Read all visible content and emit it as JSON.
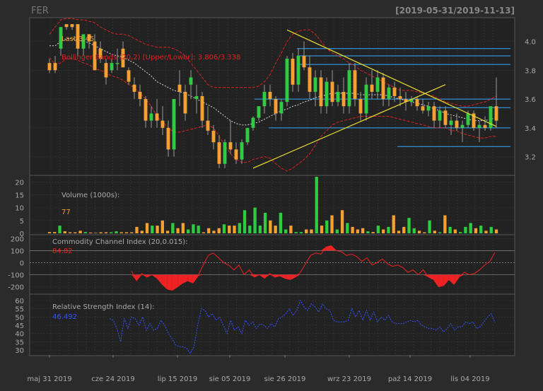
{
  "header": {
    "symbol": "FER",
    "range": "[2019-05-31/2019-11-13]"
  },
  "colors": {
    "background": "#2b2b2b",
    "panel": "#222222",
    "grid": "#444444",
    "up": "#2ecc40",
    "down": "#f5a030",
    "bollinger": "#dd2222",
    "bollinger_mid": "#dddddd",
    "trend": "#e8e030",
    "levels": "#33aaff",
    "cci": "#ee2222",
    "rsi": "#3355ff",
    "text": "#aaaaaa"
  },
  "chart_data": [
    {
      "type": "candlestick",
      "panel": "price",
      "legend": [
        {
          "text": "Last 3.45",
          "color": "#f5a030"
        },
        {
          "text": "Bollinger Bands (20,2) [Upper/Lower]: 3.806/3.338",
          "color": "#dd2222"
        }
      ],
      "y_ticks": [
        "4.0",
        "3.8",
        "3.6",
        "3.4",
        "3.2"
      ],
      "ylim": [
        3.08,
        4.16
      ],
      "x_labels": [
        "maj 31 2019",
        "cze 24 2019",
        "lip 15 2019",
        "sie 05 2019",
        "sie 26 2019",
        "wrz 23 2019",
        "paź 14 2019",
        "lis 04 2019"
      ],
      "horizontal_levels": [
        3.95,
        3.9,
        3.84,
        3.6,
        3.54,
        3.4,
        3.27
      ],
      "ohlc": [
        [
          3.85,
          3.88,
          3.78,
          3.8
        ],
        [
          3.85,
          3.9,
          3.78,
          3.8
        ],
        [
          3.95,
          4.1,
          3.9,
          4.1
        ],
        [
          4.12,
          4.12,
          4.08,
          4.1
        ],
        [
          4.12,
          4.12,
          4.08,
          4.1
        ],
        [
          4.12,
          4.12,
          3.9,
          3.95
        ],
        [
          3.95,
          4.05,
          3.9,
          4.05
        ],
        [
          4.05,
          4.05,
          3.95,
          4.0
        ],
        [
          4.0,
          4.05,
          3.8,
          3.8
        ],
        [
          3.95,
          4.0,
          3.85,
          3.88
        ],
        [
          3.85,
          3.88,
          3.7,
          3.75
        ],
        [
          3.8,
          3.88,
          3.78,
          3.85
        ],
        [
          3.85,
          3.95,
          3.8,
          3.85
        ],
        [
          3.95,
          4.0,
          3.82,
          3.82
        ],
        [
          3.8,
          3.82,
          3.7,
          3.72
        ],
        [
          3.7,
          3.75,
          3.6,
          3.65
        ],
        [
          3.65,
          3.7,
          3.55,
          3.6
        ],
        [
          3.6,
          3.62,
          3.4,
          3.45
        ],
        [
          3.45,
          3.55,
          3.4,
          3.5
        ],
        [
          3.5,
          3.6,
          3.4,
          3.45
        ],
        [
          3.45,
          3.55,
          3.35,
          3.4
        ],
        [
          3.4,
          3.45,
          3.2,
          3.25
        ],
        [
          3.25,
          3.6,
          3.2,
          3.6
        ],
        [
          3.7,
          3.8,
          3.55,
          3.65
        ],
        [
          3.65,
          3.7,
          3.45,
          3.5
        ],
        [
          3.7,
          3.8,
          3.6,
          3.75
        ],
        [
          3.6,
          3.7,
          3.5,
          3.62
        ],
        [
          3.62,
          3.65,
          3.4,
          3.45
        ],
        [
          3.45,
          3.55,
          3.35,
          3.38
        ],
        [
          3.38,
          3.42,
          3.25,
          3.3
        ],
        [
          3.3,
          3.35,
          3.12,
          3.15
        ],
        [
          3.15,
          3.32,
          3.12,
          3.3
        ],
        [
          3.3,
          3.45,
          3.22,
          3.25
        ],
        [
          3.25,
          3.3,
          3.15,
          3.18
        ],
        [
          3.18,
          3.32,
          3.15,
          3.3
        ],
        [
          3.3,
          3.4,
          3.28,
          3.4
        ],
        [
          3.4,
          3.48,
          3.38,
          3.47
        ],
        [
          3.47,
          3.55,
          3.45,
          3.55
        ],
        [
          3.55,
          3.7,
          3.5,
          3.65
        ],
        [
          3.65,
          3.7,
          3.55,
          3.6
        ],
        [
          3.6,
          3.62,
          3.45,
          3.5
        ],
        [
          3.5,
          3.6,
          3.45,
          3.58
        ],
        [
          3.58,
          3.9,
          3.55,
          3.88
        ],
        [
          3.88,
          3.92,
          3.65,
          3.7
        ],
        [
          3.7,
          3.95,
          3.65,
          3.9
        ],
        [
          3.9,
          4.0,
          3.8,
          3.82
        ],
        [
          3.82,
          3.9,
          3.6,
          3.65
        ],
        [
          3.65,
          3.8,
          3.55,
          3.75
        ],
        [
          3.75,
          3.8,
          3.5,
          3.55
        ],
        [
          3.55,
          3.75,
          3.5,
          3.72
        ],
        [
          3.72,
          3.8,
          3.55,
          3.58
        ],
        [
          3.58,
          3.7,
          3.55,
          3.65
        ],
        [
          3.65,
          3.75,
          3.5,
          3.55
        ],
        [
          3.55,
          3.85,
          3.5,
          3.8
        ],
        [
          3.8,
          3.85,
          3.55,
          3.6
        ],
        [
          3.6,
          3.65,
          3.45,
          3.5
        ],
        [
          3.5,
          3.75,
          3.45,
          3.7
        ],
        [
          3.7,
          3.8,
          3.6,
          3.65
        ],
        [
          3.65,
          3.8,
          3.6,
          3.75
        ],
        [
          3.75,
          3.78,
          3.55,
          3.6
        ],
        [
          3.6,
          3.7,
          3.55,
          3.68
        ],
        [
          3.68,
          3.72,
          3.58,
          3.62
        ],
        [
          3.62,
          3.68,
          3.55,
          3.6
        ],
        [
          3.6,
          3.65,
          3.52,
          3.58
        ],
        [
          3.58,
          3.62,
          3.55,
          3.6
        ],
        [
          3.6,
          3.62,
          3.52,
          3.55
        ],
        [
          3.55,
          3.6,
          3.5,
          3.52
        ],
        [
          3.52,
          3.58,
          3.48,
          3.55
        ],
        [
          3.55,
          3.58,
          3.4,
          3.45
        ],
        [
          3.45,
          3.55,
          3.4,
          3.52
        ],
        [
          3.52,
          3.55,
          3.4,
          3.42
        ],
        [
          3.42,
          3.48,
          3.35,
          3.45
        ],
        [
          3.45,
          3.5,
          3.38,
          3.4
        ],
        [
          3.4,
          3.45,
          3.3,
          3.42
        ],
        [
          3.42,
          3.52,
          3.4,
          3.5
        ],
        [
          3.5,
          3.52,
          3.38,
          3.4
        ],
        [
          3.4,
          3.45,
          3.3,
          3.42
        ],
        [
          3.42,
          3.48,
          3.38,
          3.4
        ],
        [
          3.4,
          3.55,
          3.38,
          3.55
        ],
        [
          3.55,
          3.75,
          3.4,
          3.45
        ]
      ],
      "bollinger_upper": [
        4.05,
        4.1,
        4.15,
        4.16,
        4.16,
        4.15,
        4.15,
        4.14,
        4.13,
        4.1,
        4.08,
        4.06,
        4.05,
        4.05,
        4.04,
        4.02,
        4.0,
        3.98,
        3.97,
        3.96,
        3.96,
        3.96,
        3.95,
        3.93,
        3.9,
        3.85,
        3.8,
        3.75,
        3.7,
        3.68,
        3.68,
        3.68,
        3.68,
        3.68,
        3.68,
        3.68,
        3.68,
        3.69,
        3.72,
        3.77,
        3.85,
        3.92,
        4.0,
        4.05,
        4.07,
        4.08,
        4.08,
        4.05,
        4.0,
        3.95,
        3.92,
        3.9,
        3.88,
        3.85,
        3.83,
        3.8,
        3.78,
        3.76,
        3.74,
        3.72,
        3.7,
        3.68,
        3.66,
        3.66,
        3.66,
        3.65,
        3.64,
        3.63,
        3.62,
        3.6,
        3.58,
        3.57,
        3.56,
        3.55,
        3.55,
        3.56,
        3.57,
        3.58,
        3.6,
        3.62
      ],
      "bollinger_middle": [
        3.97,
        3.97,
        4.0,
        4.02,
        4.02,
        4.01,
        4.0,
        3.99,
        3.97,
        3.95,
        3.93,
        3.91,
        3.9,
        3.89,
        3.87,
        3.85,
        3.82,
        3.79,
        3.76,
        3.72,
        3.7,
        3.68,
        3.66,
        3.65,
        3.64,
        3.62,
        3.6,
        3.58,
        3.56,
        3.54,
        3.51,
        3.48,
        3.45,
        3.43,
        3.42,
        3.42,
        3.43,
        3.44,
        3.46,
        3.48,
        3.5,
        3.52,
        3.53,
        3.55,
        3.56,
        3.58,
        3.59,
        3.61,
        3.62,
        3.63,
        3.64,
        3.64,
        3.64,
        3.64,
        3.64,
        3.63,
        3.63,
        3.63,
        3.63,
        3.63,
        3.62,
        3.61,
        3.6,
        3.59,
        3.58,
        3.57,
        3.56,
        3.55,
        3.53,
        3.52,
        3.5,
        3.49,
        3.48,
        3.47,
        3.46,
        3.45,
        3.45,
        3.45,
        3.46,
        3.47
      ],
      "bollinger_lower": [
        3.89,
        3.84,
        3.85,
        3.88,
        3.88,
        3.87,
        3.85,
        3.84,
        3.81,
        3.8,
        3.78,
        3.76,
        3.75,
        3.73,
        3.7,
        3.68,
        3.64,
        3.6,
        3.55,
        3.48,
        3.44,
        3.4,
        3.37,
        3.37,
        3.38,
        3.39,
        3.4,
        3.41,
        3.42,
        3.4,
        3.34,
        3.28,
        3.22,
        3.18,
        3.16,
        3.16,
        3.18,
        3.19,
        3.2,
        3.19,
        3.15,
        3.12,
        3.1,
        3.12,
        3.15,
        3.18,
        3.22,
        3.28,
        3.34,
        3.38,
        3.42,
        3.44,
        3.45,
        3.46,
        3.47,
        3.48,
        3.48,
        3.48,
        3.48,
        3.48,
        3.48,
        3.47,
        3.46,
        3.45,
        3.44,
        3.43,
        3.42,
        3.41,
        3.4,
        3.4,
        3.4,
        3.38,
        3.38,
        3.36,
        3.35,
        3.34,
        3.33,
        3.33,
        3.34,
        3.34
      ],
      "trendlines": [
        {
          "from": [
            42,
            4.08
          ],
          "to": [
            79,
            3.41
          ]
        },
        {
          "from": [
            36,
            3.12
          ],
          "to": [
            70,
            3.7
          ]
        }
      ]
    },
    {
      "type": "bar",
      "panel": "volume",
      "legend": [
        {
          "text": "Volume (1000s):",
          "color": "#aaaaaa"
        },
        {
          "text": "77",
          "color": "#f5a030"
        }
      ],
      "y_ticks": [
        "20",
        "15",
        "10",
        "5",
        "0"
      ],
      "ylim": [
        0,
        22
      ],
      "values": [
        0.5,
        0.5,
        3,
        0.8,
        0.4,
        0.4,
        1,
        0.5,
        0.3,
        0.2,
        0.4,
        0.4,
        0.4,
        0.8,
        0.4,
        0.4,
        0.4,
        2.5,
        1,
        4,
        3,
        3,
        5,
        1,
        4,
        2,
        4,
        1.5,
        3.5,
        3,
        0.4,
        2,
        1,
        2,
        3.5,
        3,
        3,
        4,
        9,
        3,
        10,
        3,
        8,
        5,
        3,
        8,
        1.5,
        3,
        0.5,
        0.5,
        1.5,
        1.5,
        22,
        3,
        5,
        7,
        1.5,
        9,
        4,
        2.5,
        1.5,
        2,
        0.8,
        0.5,
        3,
        1.5,
        2.5,
        7,
        1,
        2.5,
        6,
        2,
        1,
        0.4,
        5,
        1,
        0.4,
        7,
        2.5,
        1.5,
        0.5,
        2.5,
        4,
        2,
        3,
        1,
        2.5,
        1.5
      ]
    },
    {
      "type": "area",
      "panel": "cci",
      "legend": [
        {
          "text": "Commodity Channel Index (20,0.015):",
          "color": "#aaaaaa"
        },
        {
          "text": "84.82",
          "color": "#ee2222"
        }
      ],
      "y_ticks": [
        "200",
        "100",
        "0",
        "-100",
        "-200"
      ],
      "ylim": [
        -250,
        220
      ],
      "values": [
        -70,
        -150,
        -90,
        -120,
        -100,
        -130,
        -180,
        -220,
        -230,
        -200,
        -170,
        -150,
        -170,
        -110,
        -20,
        60,
        80,
        40,
        0,
        -20,
        -60,
        -20,
        -100,
        -60,
        -120,
        -100,
        -130,
        -90,
        -120,
        -110,
        -130,
        -140,
        -120,
        -80,
        -10,
        60,
        80,
        70,
        130,
        140,
        100,
        90,
        60,
        70,
        50,
        10,
        40,
        -20,
        0,
        30,
        -10,
        -30,
        -20,
        -40,
        -80,
        -60,
        -100,
        -60,
        -120,
        -140,
        -200,
        -190,
        -140,
        -180,
        -120,
        -80,
        -100,
        -90,
        -60,
        -20,
        10,
        84.82
      ]
    },
    {
      "type": "line",
      "panel": "rsi",
      "legend": [
        {
          "text": "Relative Strength Index (14):",
          "color": "#aaaaaa"
        },
        {
          "text": "46.492",
          "color": "#3355ff"
        }
      ],
      "y_ticks": [
        "60",
        "55",
        "50",
        "45",
        "40",
        "35",
        "30"
      ],
      "ylim": [
        27,
        63
      ],
      "values": [
        49,
        48,
        43,
        35,
        49,
        43,
        50,
        49,
        45,
        50,
        42,
        46,
        42,
        43,
        48,
        45,
        40,
        37,
        33,
        32,
        32,
        31,
        28,
        32,
        45,
        55,
        54,
        50,
        52,
        48,
        50,
        45,
        40,
        48,
        42,
        44,
        40,
        48,
        45,
        47,
        43,
        46,
        45,
        43,
        46,
        44,
        49,
        50,
        52,
        55,
        51,
        54,
        60,
        56,
        54,
        58,
        56,
        53,
        58,
        55,
        54,
        48,
        47,
        47,
        47,
        48,
        55,
        50,
        54,
        48,
        54,
        48,
        53,
        47,
        50,
        48,
        51,
        47,
        46,
        46,
        46,
        47,
        48,
        47,
        48,
        45,
        44,
        43,
        43,
        42,
        44,
        41,
        43,
        46,
        42,
        44,
        44,
        47,
        46,
        47,
        43,
        44,
        47,
        50,
        52,
        46.492
      ]
    }
  ]
}
